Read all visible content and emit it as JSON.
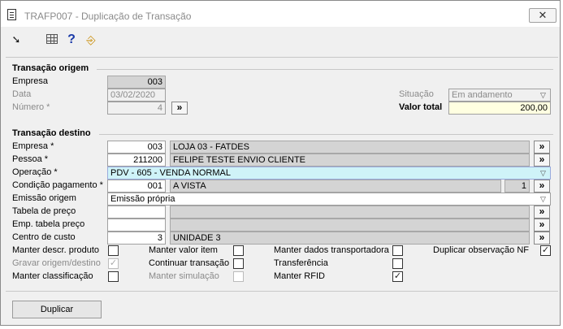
{
  "window": {
    "title": "TRAFP007 - Duplicação de Transação",
    "close_glyph": "✕"
  },
  "toolbar": {
    "icons": [
      "arrow-icon",
      "grid-icon",
      "help-icon",
      "exit-icon"
    ],
    "arrow_glyph": "➘",
    "help_glyph": "?",
    "exit_glyph": "⎆"
  },
  "origem": {
    "title": "Transação origem",
    "empresa_label": "Empresa",
    "empresa_value": "003",
    "data_label": "Data",
    "data_value": "03/02/2020",
    "numero_label": "Número *",
    "numero_value": "4",
    "situacao_label": "Situação",
    "situacao_value": "Em andamento",
    "valor_label": "Valor total",
    "valor_value": "200,00"
  },
  "destino": {
    "title": "Transação destino",
    "empresa_label": "Empresa *",
    "empresa_code": "003",
    "empresa_name": "LOJA 03 - FATDES",
    "pessoa_label": "Pessoa *",
    "pessoa_code": "211200",
    "pessoa_name": "FELIPE TESTE ENVIO CLIENTE",
    "operacao_label": "Operação *",
    "operacao_value": "PDV - 605 - VENDA NORMAL",
    "condicao_label": "Condição pagamento *",
    "condicao_code": "001",
    "condicao_name": "A VISTA",
    "condicao_qty": "1",
    "emissao_label": "Emissão origem",
    "emissao_value": "Emissão própria",
    "tabela_label": "Tabela de preço",
    "tabela_code": "",
    "tabela_name": "",
    "emp_tabela_label": "Emp. tabela preço",
    "emp_tabela_code": "",
    "emp_tabela_name": "",
    "centro_label": "Centro de custo",
    "centro_code": "3",
    "centro_name": "UNIDADE 3",
    "lookup_glyph": "»",
    "dropdown_glyph": "▽"
  },
  "checkboxes": {
    "manter_descr": {
      "label": "Manter descr. produto",
      "checked": ""
    },
    "gravar_origem": {
      "label": "Gravar origem/destino",
      "checked": "✓"
    },
    "manter_classificacao": {
      "label": "Manter classificação",
      "checked": ""
    },
    "manter_valor": {
      "label": "Manter valor item",
      "checked": ""
    },
    "continuar": {
      "label": "Continuar transação",
      "checked": ""
    },
    "manter_simulacao": {
      "label": "Manter simulação",
      "checked": ""
    },
    "manter_transportadora": {
      "label": "Manter dados transportadora",
      "checked": ""
    },
    "transferencia": {
      "label": "Transferência",
      "checked": ""
    },
    "manter_rfid": {
      "label": "Manter RFID",
      "checked": "✓"
    },
    "duplicar_obs": {
      "label": "Duplicar observação NF",
      "checked": "✓"
    }
  },
  "actions": {
    "duplicar_label": "Duplicar"
  }
}
